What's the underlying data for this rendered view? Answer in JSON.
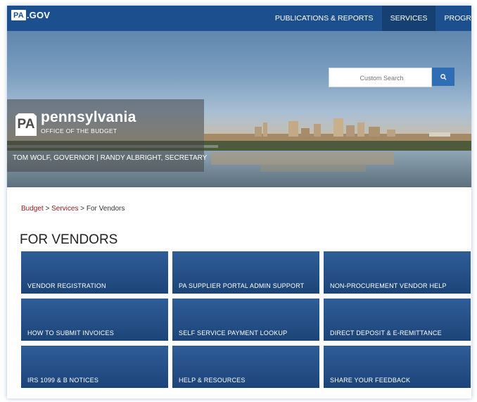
{
  "header": {
    "logo_key": "PA",
    "logo_text": ".GOV",
    "nav": [
      "PUBLICATIONS & REPORTS",
      "SERVICES",
      "PROGR"
    ],
    "active_nav": "SERVICES"
  },
  "search": {
    "placeholder": "Custom Search"
  },
  "brand": {
    "key": "PA",
    "title": "pennsylvania",
    "subtitle": "OFFICE OF THE BUDGET",
    "officials": "TOM WOLF, GOVERNOR  |  RANDY ALBRIGHT, SECRETARY"
  },
  "breadcrumb": {
    "items": [
      "Budget",
      "Services"
    ],
    "current": "For Vendors",
    "separator": ">"
  },
  "page_title": "FOR VENDORS",
  "tiles": [
    "VENDOR REGISTRATION",
    "PA SUPPLIER PORTAL ADMIN SUPPORT",
    "NON-PROCUREMENT VENDOR HELP",
    "HOW TO SUBMIT INVOICES",
    "SELF SERVICE PAYMENT LOOKUP",
    "DIRECT DEPOSIT & E-REMITTANCE",
    "IRS 1099 & B NOTICES",
    "HELP & RESOURCES",
    "SHARE YOUR FEEDBACK"
  ],
  "colors": {
    "nav_bg": "#1c4f8e",
    "tile_bg": "#1c4478",
    "link": "#8b1a1a",
    "search_btn": "#2f6db5"
  },
  "icons": {
    "search": "search-icon"
  }
}
